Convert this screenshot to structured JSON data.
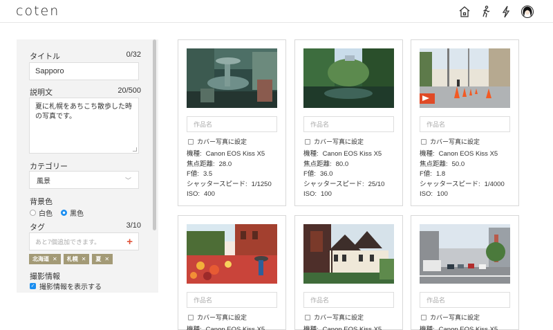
{
  "app": {
    "logo": "coten"
  },
  "header": {
    "icons": [
      "home-icon",
      "walking-icon",
      "lightning-icon",
      "avatar"
    ]
  },
  "sidebar": {
    "title_label": "タイトル",
    "title_count": "0/32",
    "title_value": "Sapporo",
    "desc_label": "説明文",
    "desc_count": "20/500",
    "desc_value": "夏に札幌をあちこち散歩した時の写真です。",
    "category_label": "カテゴリー",
    "category_value": "風景",
    "bg_label": "背景色",
    "bg_white": "白色",
    "bg_black": "黒色",
    "tag_label": "タグ",
    "tag_count": "3/10",
    "tag_placeholder": "あと7個追加できます。",
    "tags": [
      "北海道",
      "札幌",
      "夏"
    ],
    "photo_info_label": "撮影情報",
    "photo_info_toggle": "撮影情報を表示する"
  },
  "cards_common": {
    "title_placeholder": "作品名",
    "cover_label": "カバー写真に設定",
    "k_model": "機種:",
    "k_focal": "焦点距離:",
    "k_f": "F値:",
    "k_shutter": "シャッタースピード:",
    "k_iso": "ISO:"
  },
  "cards": [
    {
      "model": "Canon EOS Kiss X5",
      "focal": "28.0",
      "f": "3.5",
      "shutter": "1/1250",
      "iso": "400"
    },
    {
      "model": "Canon EOS Kiss X5",
      "focal": "80.0",
      "f": "36.0",
      "shutter": "25/10",
      "iso": "100"
    },
    {
      "model": "Canon EOS Kiss X5",
      "focal": "50.0",
      "f": "1.8",
      "shutter": "1/4000",
      "iso": "100"
    },
    {
      "model": "Canon EOS Kiss X5"
    },
    {
      "model": "Canon EOS Kiss X5"
    },
    {
      "model": "Canon EOS Kiss X5"
    }
  ],
  "colors": {
    "accent_blue": "#1b8ef0",
    "tag_bg": "#a39a76",
    "plus": "#e0533a"
  }
}
